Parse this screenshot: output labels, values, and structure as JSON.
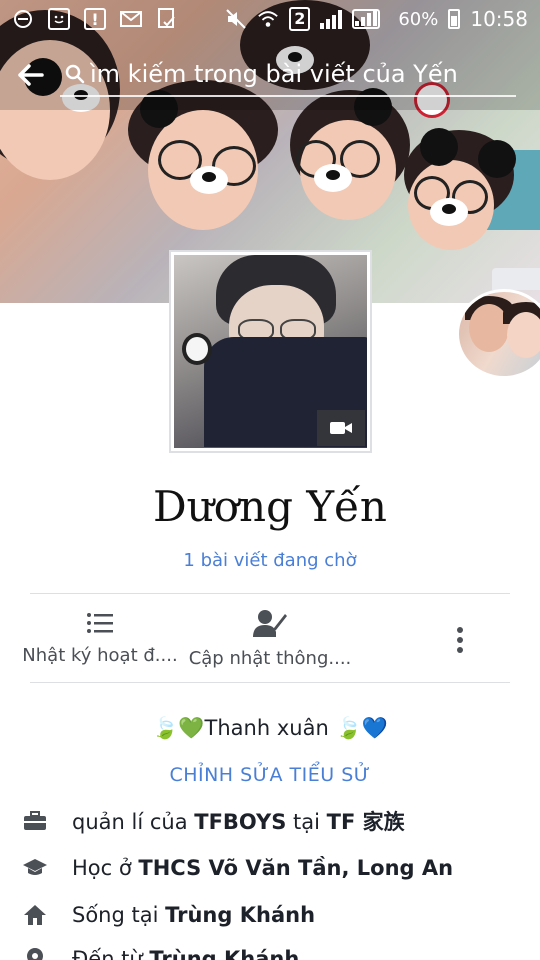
{
  "status_bar": {
    "battery": "60%",
    "time": "10:58",
    "sim_slot": "2"
  },
  "search": {
    "placeholder": "ìm kiếm trong bài viết của Yến"
  },
  "profile": {
    "name": "Dương Yến",
    "pending_posts": "1 bài viết đang chờ"
  },
  "actions": {
    "activity_log": "Nhật ký hoạt đ....",
    "update_info": "Cập nhật thông...."
  },
  "bio": {
    "text": "Thanh xuân",
    "edit_label": "CHỈNH SỬA TIỂU SỬ"
  },
  "intro": {
    "work": {
      "prefix": "quản lí của ",
      "org": "TFBOYS",
      "mid": " tại ",
      "place": "TF 家族"
    },
    "education": {
      "prefix": "Học ở ",
      "school": "THCS Võ Văn Tần, Long An"
    },
    "lives": {
      "prefix": "Sống tại ",
      "place": "Trùng Khánh"
    },
    "from": {
      "prefix": "Đến từ ",
      "place": "Trùng Khánh"
    }
  },
  "colors": {
    "link_blue": "#4a7fd6",
    "text_dark": "#1d2129",
    "icon_gray": "#4b4f56"
  },
  "icons": [
    "minus-circle-icon",
    "sms-face-icon",
    "alert-icon",
    "mail-icon",
    "check-file-icon",
    "mute-icon",
    "wifi-icon",
    "signal-icon",
    "battery-icon",
    "back-arrow-icon",
    "search-icon",
    "video-camera-icon",
    "list-icon",
    "person-edit-icon",
    "more-vertical-icon",
    "briefcase-icon",
    "graduation-cap-icon",
    "home-icon",
    "location-pin-icon"
  ]
}
